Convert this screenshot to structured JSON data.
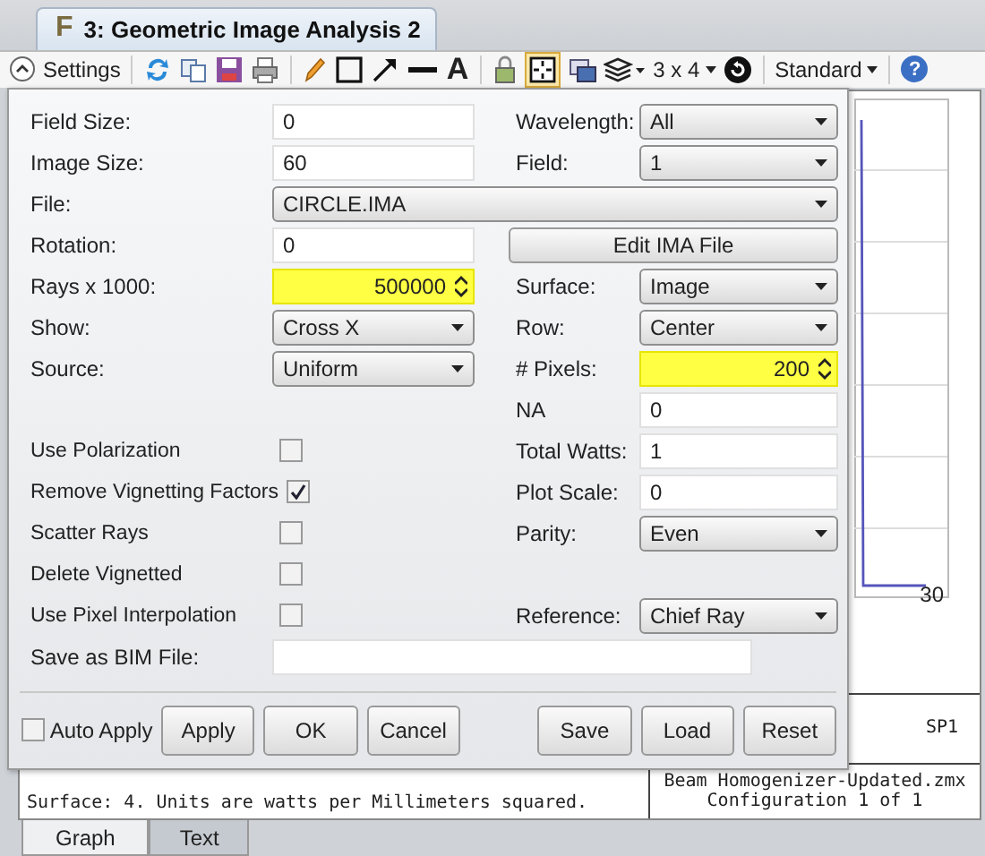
{
  "window": {
    "logo": "F",
    "title": "3: Geometric Image Analysis 2"
  },
  "toolbar": {
    "settings": "Settings",
    "text_tool": "A",
    "grid_on": true,
    "layout": "3 x 4",
    "mode": "Standard",
    "help": "?"
  },
  "settings": {
    "rows": [
      {
        "left": {
          "kind": "text",
          "label": "Field Size:",
          "value": "0"
        },
        "right": {
          "kind": "select",
          "label": "Wavelength:",
          "value": "All"
        }
      },
      {
        "left": {
          "kind": "text",
          "label": "Image Size:",
          "value": "60"
        },
        "right": {
          "kind": "select",
          "label": "Field:",
          "value": "1"
        }
      },
      {
        "left": {
          "kind": "wide_select",
          "label": "File:",
          "value": "CIRCLE.IMA"
        }
      },
      {
        "left": {
          "kind": "text",
          "label": "Rotation:",
          "value": "0"
        },
        "right": {
          "kind": "button",
          "label": "Edit IMA File"
        }
      },
      {
        "left": {
          "kind": "spin",
          "label": "Rays x 1000:",
          "value": "500000"
        },
        "right": {
          "kind": "select",
          "label": "Surface:",
          "value": "Image"
        }
      },
      {
        "left": {
          "kind": "select",
          "label": "Show:",
          "value": "Cross X"
        },
        "right": {
          "kind": "select",
          "label": "Row:",
          "value": "Center"
        }
      },
      {
        "left": {
          "kind": "select",
          "label": "Source:",
          "value": "Uniform"
        },
        "right": {
          "kind": "spin",
          "label": "# Pixels:",
          "value": "200"
        }
      },
      {
        "right": {
          "kind": "text",
          "label": "NA",
          "value": "0"
        }
      },
      {
        "left": {
          "kind": "checkbox",
          "label": "Use Polarization",
          "checked": false
        },
        "right": {
          "kind": "text",
          "label": "Total Watts:",
          "value": "1"
        }
      },
      {
        "left": {
          "kind": "checkbox",
          "label": "Remove Vignetting Factors",
          "checked": true
        },
        "right": {
          "kind": "text",
          "label": "Plot Scale:",
          "value": "0"
        }
      },
      {
        "left": {
          "kind": "checkbox",
          "label": "Scatter Rays",
          "checked": false
        },
        "right": {
          "kind": "select",
          "label": "Parity:",
          "value": "Even"
        }
      },
      {
        "left": {
          "kind": "checkbox",
          "label": "Delete Vignetted",
          "checked": false
        }
      },
      {
        "left": {
          "kind": "checkbox",
          "label": "Use Pixel Interpolation",
          "checked": false
        },
        "right": {
          "kind": "select",
          "label": "Reference:",
          "value": "Chief Ray"
        }
      },
      {
        "left": {
          "kind": "wide_text",
          "label": "Save as BIM File:"
        }
      }
    ],
    "auto_apply": {
      "label": "Auto Apply",
      "checked": false
    },
    "buttons_left": [
      "Apply",
      "OK",
      "Cancel"
    ],
    "buttons_right": [
      "Save",
      "Load",
      "Reset"
    ]
  },
  "graph": {
    "tick_label": "30",
    "info_top": "SP1",
    "surface_note": "Surface: 4. Units are watts per Millimeters squared.",
    "file": "Beam Homogenizer-Updated.zmx",
    "configuration": "Configuration 1 of 1"
  },
  "bottom_tabs": [
    {
      "label": "Graph",
      "selected": true
    },
    {
      "label": "Text",
      "selected": false
    }
  ]
}
